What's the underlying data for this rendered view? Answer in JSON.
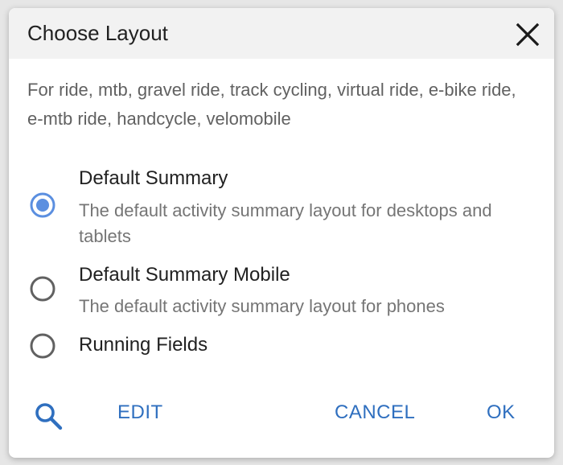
{
  "dialog": {
    "title": "Choose Layout",
    "close_icon": "close-icon",
    "description": "For ride, mtb, gravel ride, track cycling, virtual ride, e-bike ride, e-mtb ride, handcycle, velomobile"
  },
  "options": [
    {
      "title": "Default Summary",
      "description": "The default activity summary layout for desktops and tablets",
      "selected": true
    },
    {
      "title": "Default Summary Mobile",
      "description": "The default activity summary layout for phones",
      "selected": false
    },
    {
      "title": "Running Fields",
      "description": "",
      "selected": false
    }
  ],
  "actions": {
    "search_icon": "search-icon",
    "edit_label": "EDIT",
    "cancel_label": "CANCEL",
    "ok_label": "OK"
  },
  "colors": {
    "accent": "#2f6fbf",
    "radio_selected": "#5b8fe0",
    "radio_unselected": "#616161"
  }
}
